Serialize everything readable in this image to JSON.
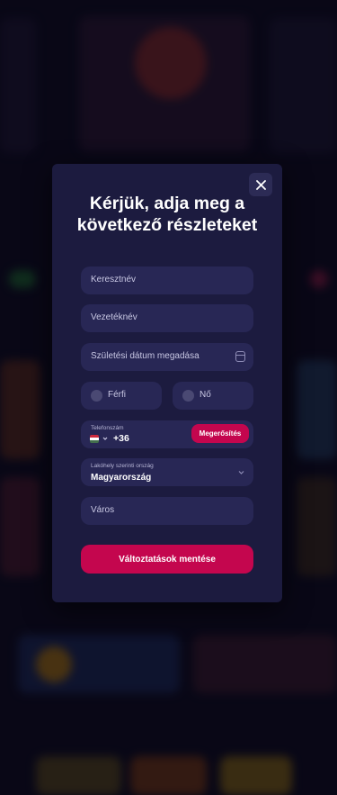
{
  "colors": {
    "modal_bg": "#1c1b3f",
    "field_bg": "#282755",
    "accent": "#c4064e",
    "page_bg": "#0b0a1c"
  },
  "modal": {
    "title": "Kérjük, adja meg a következő részleteket",
    "close_icon": "close-icon",
    "first_name": {
      "placeholder": "Keresztnév",
      "value": ""
    },
    "last_name": {
      "placeholder": "Vezetéknév",
      "value": ""
    },
    "birth_date": {
      "placeholder": "Születési dátum megadása",
      "icon": "calendar-icon"
    },
    "gender": {
      "options": [
        "Férfi",
        "Nő"
      ],
      "selected": null
    },
    "phone": {
      "label": "Telefonszám",
      "flag": "hungary-flag-icon",
      "dial_code": "+36",
      "verify_label": "Megerősítés"
    },
    "country": {
      "label": "Lakóhely szerinti ország",
      "value": "Magyarország",
      "icon": "chevron-down-icon"
    },
    "city": {
      "placeholder": "Város",
      "value": ""
    },
    "save_label": "Változtatások mentése"
  }
}
